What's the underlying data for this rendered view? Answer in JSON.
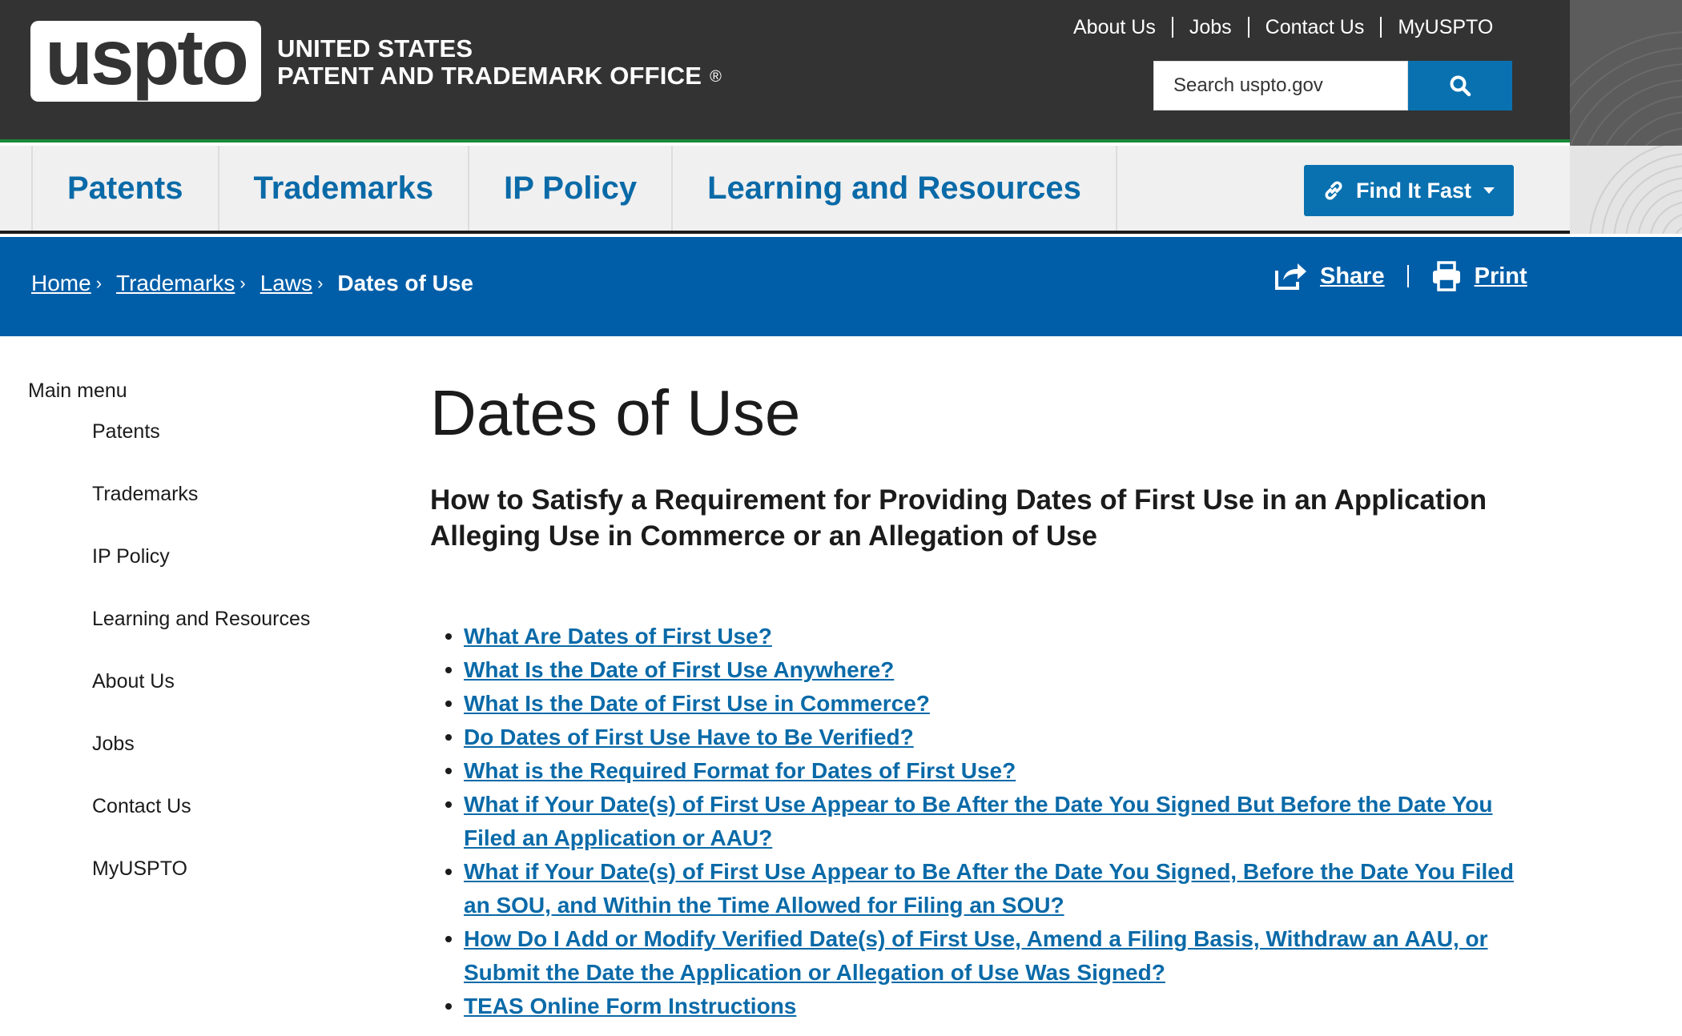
{
  "header": {
    "logo_text": "uspto",
    "agency_line1": "UNITED STATES",
    "agency_line2": "PATENT AND TRADEMARK OFFICE",
    "registered_mark": "®",
    "utility_nav": [
      "About Us",
      "Jobs",
      "Contact Us",
      "MyUSPTO"
    ],
    "search_placeholder": "Search uspto.gov"
  },
  "main_nav": {
    "items": [
      "Patents",
      "Trademarks",
      "IP Policy",
      "Learning and Resources"
    ],
    "find_it_fast": "Find It Fast"
  },
  "breadcrumb": {
    "items": [
      "Home",
      "Trademarks",
      "Laws"
    ],
    "current": "Dates of Use",
    "share": "Share",
    "print": "Print"
  },
  "sidebar": {
    "heading": "Main menu",
    "items": [
      "Patents",
      "Trademarks",
      "IP Policy",
      "Learning and Resources",
      "About Us",
      "Jobs",
      "Contact Us",
      "MyUSPTO"
    ]
  },
  "content": {
    "title": "Dates of Use",
    "subtitle": "How to Satisfy a Requirement for Providing Dates of First Use in an Application Alleging Use in Commerce or an Allegation of Use",
    "links": [
      "What Are Dates of First Use?",
      "What Is the Date of First Use Anywhere?",
      "What Is the Date of First Use in Commerce?",
      "Do Dates of First Use Have to Be Verified?",
      "What is the Required Format for Dates of First Use?",
      "What if Your Date(s) of First Use Appear to Be After the Date You Signed But Before the Date You Filed an Application or AAU?",
      "What if Your Date(s) of First Use Appear to Be After the Date You Signed, Before the Date You Filed an SOU, and Within the Time Allowed for Filing an SOU?",
      "How Do I Add or Modify Verified Date(s) of First Use, Amend a Filing Basis, Withdraw an AAU, or Submit the Date the Application or Allegation of Use Was Signed?",
      "TEAS Online Form Instructions"
    ]
  },
  "colors": {
    "header_bg": "#333333",
    "accent_blue": "#0a71b0",
    "breadcrumb_bg": "#005ea8",
    "link_blue": "#0a6aa8",
    "header_rule_green": "#1a8a3a"
  }
}
